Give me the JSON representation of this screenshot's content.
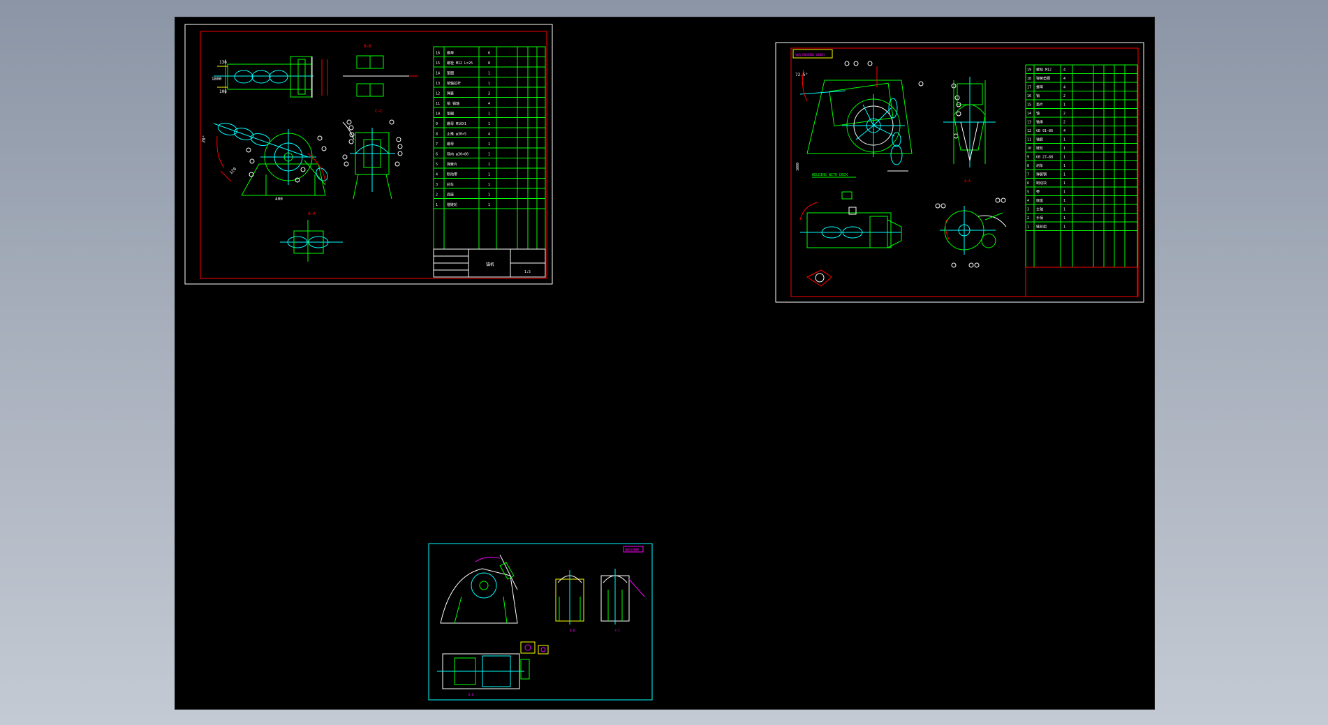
{
  "sheet1": {
    "dims": [
      "136",
      "1800",
      "106",
      "400",
      "700",
      "80",
      "400",
      "20°",
      "120°",
      "1000"
    ],
    "section_labels": [
      "B—B",
      "C—C",
      "A—A",
      "D"
    ],
    "bom_rows": [
      {
        "no": "16",
        "name": "螺母",
        "qty": "6"
      },
      {
        "no": "15",
        "name": "螺栓  M12 L=25",
        "qty": "8"
      },
      {
        "no": "14",
        "name": "垫圈",
        "qty": "1"
      },
      {
        "no": "13",
        "name": "销轴拉杆",
        "qty": "1"
      },
      {
        "no": "12",
        "name": "弹簧",
        "qty": "2"
      },
      {
        "no": "11",
        "name": "销  销轴",
        "qty": "4"
      },
      {
        "no": "10",
        "name": "垫圈",
        "qty": "1"
      },
      {
        "no": "9",
        "name": "螺母  M16X1",
        "qty": "1"
      },
      {
        "no": "8",
        "name": "止推  φ30×5",
        "qty": "4"
      },
      {
        "no": "7",
        "name": "螺母",
        "qty": "1"
      },
      {
        "no": "6",
        "name": "导向  φ30×80",
        "qty": "1"
      },
      {
        "no": "5",
        "name": "弹簧片",
        "qty": "1"
      },
      {
        "no": "4",
        "name": "制动带",
        "qty": "1"
      },
      {
        "no": "3",
        "name": "刹车",
        "qty": "1"
      },
      {
        "no": "2",
        "name": "底座",
        "qty": "1"
      },
      {
        "no": "1",
        "name": "锚链轮",
        "qty": "1"
      }
    ],
    "header_row": [
      "序",
      "代号",
      "名称",
      "数量",
      "材料",
      "备注"
    ],
    "title_text": "锚机",
    "scale_text": "1:5"
  },
  "sheet2": {
    "title_box": "锚机 MOORING WINCH",
    "annotation": "WELDING WITH DECK",
    "dims": [
      "72.5°",
      "1000",
      "260",
      "1720.5",
      "120"
    ],
    "bom_rows": [
      {
        "no": "19",
        "name": "螺栓  M12",
        "qty": "4"
      },
      {
        "no": "18",
        "name": "弹簧垫圈",
        "qty": "4"
      },
      {
        "no": "17",
        "name": "螺母",
        "qty": "4"
      },
      {
        "no": "16",
        "name": "销",
        "qty": "2"
      },
      {
        "no": "15",
        "name": "垫片",
        "qty": "1"
      },
      {
        "no": "14",
        "name": "轴",
        "qty": "2"
      },
      {
        "no": "13",
        "name": "轴承",
        "qty": "2"
      },
      {
        "no": "12",
        "name": "GB 91—86",
        "qty": "4"
      },
      {
        "no": "11",
        "name": "轴套",
        "qty": "1"
      },
      {
        "no": "10",
        "name": "链轮",
        "qty": "1"
      },
      {
        "no": "9",
        "name": "GB 27—88",
        "qty": "1"
      },
      {
        "no": "8",
        "name": "刹车",
        "qty": "1"
      },
      {
        "no": "7",
        "name": "弹簧钢",
        "qty": "1"
      },
      {
        "no": "6",
        "name": "制动块",
        "qty": "1"
      },
      {
        "no": "5",
        "name": "带",
        "qty": "1"
      },
      {
        "no": "4",
        "name": "底座",
        "qty": "1"
      },
      {
        "no": "3",
        "name": "主轴",
        "qty": "1"
      },
      {
        "no": "2",
        "name": "手柄",
        "qty": "1"
      },
      {
        "no": "1",
        "name": "链轮组",
        "qty": "1"
      }
    ]
  },
  "sheet3": {
    "title_box": "锚机总装图",
    "section_labels": [
      "A-A",
      "B-B",
      "C-C",
      "D-D"
    ]
  },
  "colors": {
    "background": "#000000",
    "frame_outer": "#ffffff",
    "frame_inner": "#ff0000",
    "geometry": "#00ff00",
    "centerline": "#00ffff",
    "text": "#ffffff",
    "dim": "#ff0000",
    "magenta": "#ff00ff",
    "yellow": "#ffff00"
  }
}
